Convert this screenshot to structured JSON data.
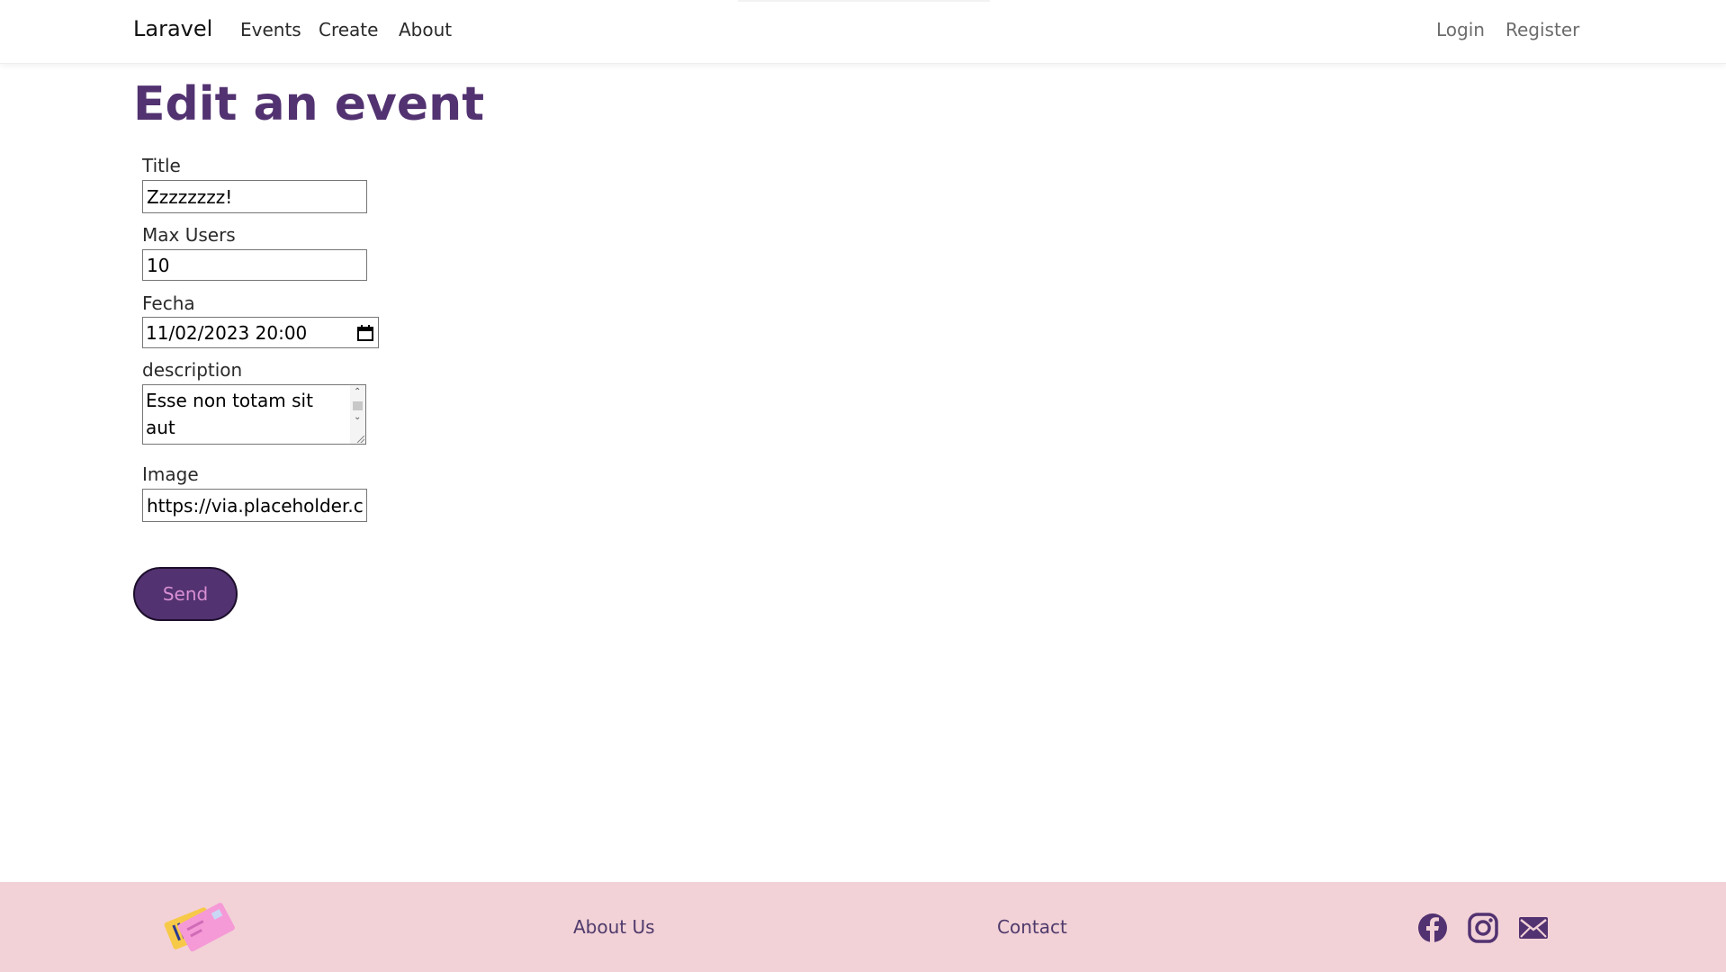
{
  "navbar": {
    "brand": "Laravel",
    "links": [
      "Events",
      "Create",
      "About"
    ],
    "auth": [
      "Login",
      "Register"
    ]
  },
  "page": {
    "title": "Edit an event"
  },
  "form": {
    "title": {
      "label": "Title",
      "value": "Zzzzzzzz!"
    },
    "max_users": {
      "label": "Max Users",
      "value": "10"
    },
    "fecha": {
      "label": "Fecha",
      "value": "11/02/2023 20:00"
    },
    "description": {
      "label": "description",
      "value": "Esse non totam sit aut\nlaborum qui magnam."
    },
    "image": {
      "label": "Image",
      "value": "https://via.placeholder.c"
    },
    "send_label": "Send"
  },
  "footer": {
    "links": [
      "About Us",
      "Contact"
    ],
    "social_icons": [
      "facebook-icon",
      "instagram-icon",
      "mail-icon"
    ]
  },
  "colors": {
    "primary": "#523270",
    "button_text": "#d98fd3",
    "footer_bg": "#f2d2d7"
  }
}
